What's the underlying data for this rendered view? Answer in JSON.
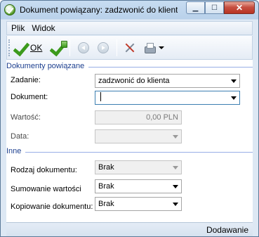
{
  "window": {
    "title": "Dokument powiązany: zadzwonić do klient...",
    "minimize_glyph": "▁",
    "maximize_glyph": "☐",
    "close_glyph": "✕"
  },
  "menu": {
    "items": [
      {
        "label": "Plik"
      },
      {
        "label": "Widok"
      }
    ]
  },
  "toolbar": {
    "ok_label": "OK"
  },
  "sections": {
    "related": {
      "title": "Dokumenty powiązane",
      "zadanie_label": "Zadanie:",
      "zadanie_value": "zadzwonić do klienta",
      "dokument_label": "Dokument:",
      "dokument_value": "",
      "wartosc_label": "Wartość:",
      "wartosc_value": "0,00 PLN",
      "data_label": "Data:",
      "data_value": ""
    },
    "other": {
      "title": "Inne",
      "rodzaj_label": "Rodzaj dokumentu:",
      "rodzaj_value": "Brak",
      "sumowanie_label": "Sumowanie wartości",
      "sumowanie_value": "Brak",
      "kopiowanie_label": "Kopiowanie dokumentu:",
      "kopiowanie_value": "Brak"
    }
  },
  "status": {
    "mode": "Dodawanie"
  }
}
